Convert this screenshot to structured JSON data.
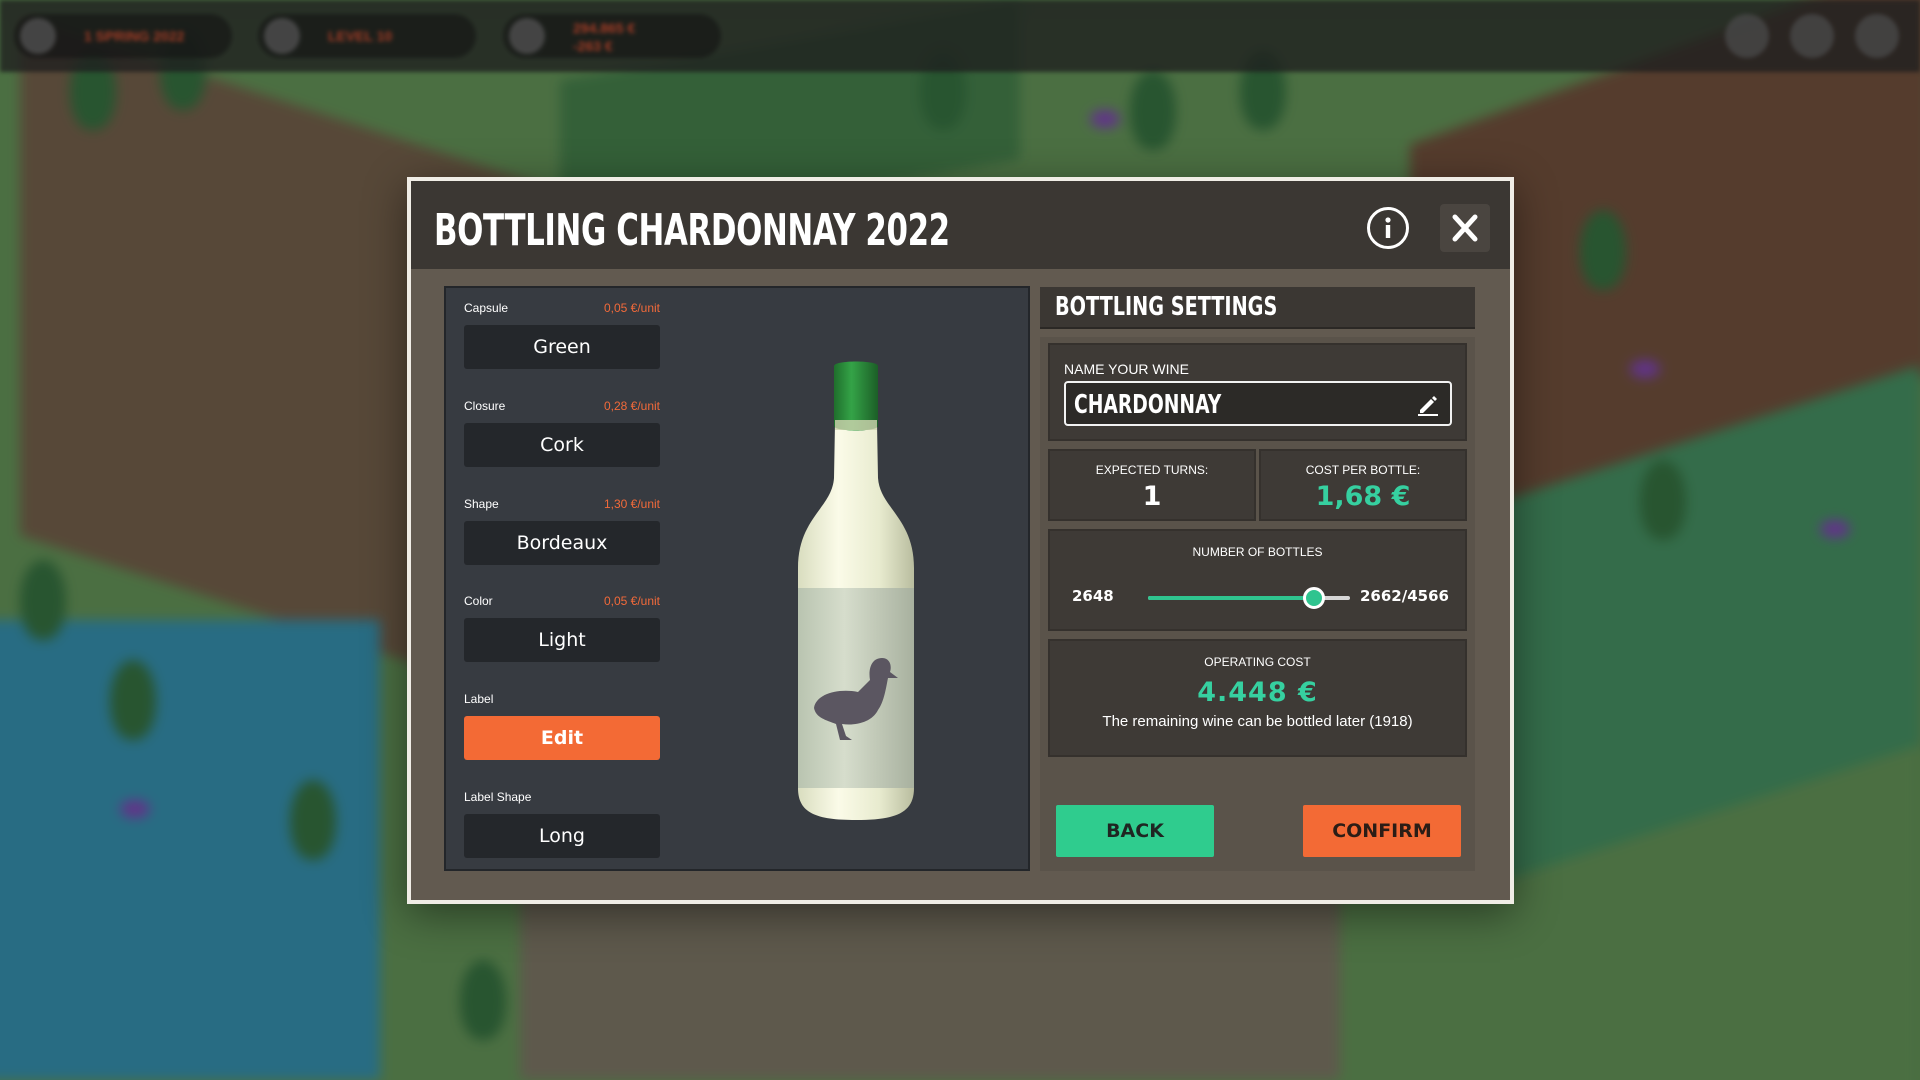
{
  "hud": {
    "season": "1 SPRING 2022",
    "level": "LEVEL 10",
    "money_main": "294.865 €",
    "money_sub": "-263 €"
  },
  "dialog": {
    "title": "BOTTLING CHARDONNAY 2022"
  },
  "options": {
    "capsule": {
      "label": "Capsule",
      "price": "0,05 €/unit",
      "value": "Green"
    },
    "closure": {
      "label": "Closure",
      "price": "0,28 €/unit",
      "value": "Cork"
    },
    "shape": {
      "label": "Shape",
      "price": "1,30 €/unit",
      "value": "Bordeaux"
    },
    "color": {
      "label": "Color",
      "price": "0,05 €/unit",
      "value": "Light"
    },
    "label": {
      "label": "Label",
      "button": "Edit"
    },
    "label_shape": {
      "label": "Label Shape",
      "value": "Long"
    }
  },
  "settings": {
    "title": "BOTTLING SETTINGS",
    "name_label": "NAME YOUR WINE",
    "wine_name": "CHARDONNAY",
    "expected_turns_label": "EXPECTED TURNS:",
    "expected_turns": "1",
    "cost_per_bottle_label": "COST PER BOTTLE:",
    "cost_per_bottle": "1,68 €",
    "bottles_label": "NUMBER OF BOTTLES",
    "bottles_min": "2648",
    "bottles_max": "2662/4566",
    "bottles_fraction": 0.82,
    "operating_cost_label": "OPERATING COST",
    "operating_cost": "4.448 €",
    "remaining_note": "The remaining wine can be bottled later (1918)",
    "back_label": "BACK",
    "confirm_label": "CONFIRM"
  },
  "colors": {
    "accent_orange": "#f36a35",
    "accent_green": "#2fcc8e",
    "capsule_green": "#2a8a3a"
  }
}
